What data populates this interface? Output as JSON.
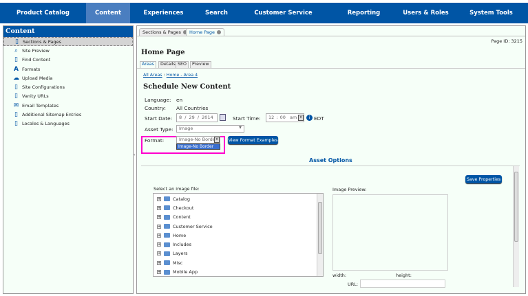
{
  "nav": [
    "Product Catalog",
    "Content",
    "Experiences",
    "Search",
    "Customer Service",
    "Reporting",
    "Users & Roles",
    "System Tools"
  ],
  "nav_active": "Content",
  "sidebar": {
    "title": "Content",
    "items": [
      {
        "label": "Sections & Pages",
        "icon": "page-icon"
      },
      {
        "label": "Site Preview",
        "icon": "magnifier-icon"
      },
      {
        "label": "Find Content",
        "icon": "find-page-icon"
      },
      {
        "label": "Formats",
        "icon": "font-icon"
      },
      {
        "label": "Upload Media",
        "icon": "cloud-upload-icon"
      },
      {
        "label": "Site Configurations",
        "icon": "page-icon"
      },
      {
        "label": "Vanity URLs",
        "icon": "page-icon"
      },
      {
        "label": "Email Templates",
        "icon": "envelope-icon"
      },
      {
        "label": "Additional Sitemap Entries",
        "icon": "page-icon"
      },
      {
        "label": "Locales & Languages",
        "icon": "page-icon"
      }
    ]
  },
  "tabs": [
    "Sections & Pages",
    "Home Page"
  ],
  "page_id": "Page ID: 3215",
  "page_title": "Home Page",
  "subtabs": [
    "Areas",
    "Details",
    "SEO",
    "Preview"
  ],
  "breadcrumb": {
    "all": "All Areas",
    "sep": ":",
    "current": "Home - Area 4"
  },
  "heading": "Schedule New Content",
  "form": {
    "language_label": "Language:",
    "language": "en",
    "country_label": "Country:",
    "country": "All Countries",
    "start_date_label": "Start Date:",
    "month": "8",
    "day": "29",
    "year": "2014",
    "start_time_label": "Start Time:",
    "hour": "12",
    "minute": "00",
    "ampm": "am",
    "tz": "EDT",
    "asset_type_label": "Asset Type:",
    "asset_type": "Image",
    "format_label": "Format:",
    "format": "Image-No Border",
    "format_option": "Image-No Border",
    "view_examples": "View Format Examples"
  },
  "asset_options": {
    "title": "Asset Options",
    "save": "Save Properties",
    "select_label": "Select an image file:",
    "preview_label": "Image Preview:",
    "width_label": "width:",
    "height_label": "height:",
    "url_label": "URL:",
    "folders": [
      "Catalog",
      "Checkout",
      "Content",
      "Customer Service",
      "Home",
      "Includes",
      "Layers",
      "Misc",
      "Mobile App"
    ]
  },
  "colors": {
    "brand": "#0055a5",
    "highlight": "#ff00cc"
  }
}
